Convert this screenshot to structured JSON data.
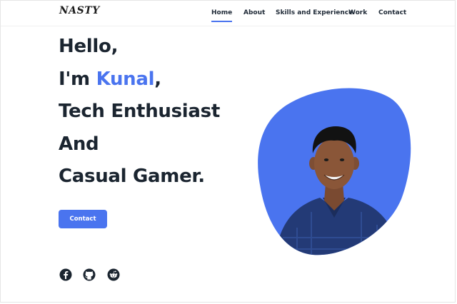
{
  "header": {
    "logo_text": "NASTY",
    "nav": [
      {
        "label": "Home",
        "active": true
      },
      {
        "label": "About",
        "active": false
      },
      {
        "label": "Skills and Experience",
        "active": false
      },
      {
        "label": "Work",
        "active": false
      },
      {
        "label": "Contact",
        "active": false
      }
    ]
  },
  "hero": {
    "line1": "Hello,",
    "line2_prefix": "I'm ",
    "line2_name": "Kunal",
    "line2_suffix": ",",
    "line3": "Tech Enthusiast",
    "line4": "And",
    "line5": "Casual Gamer.",
    "contact_button": "Contact"
  },
  "social": [
    {
      "icon": "facebook-icon"
    },
    {
      "icon": "github-icon"
    },
    {
      "icon": "reddit-icon"
    }
  ],
  "colors": {
    "accent": "#4a74ef",
    "heading": "#1b2530"
  }
}
